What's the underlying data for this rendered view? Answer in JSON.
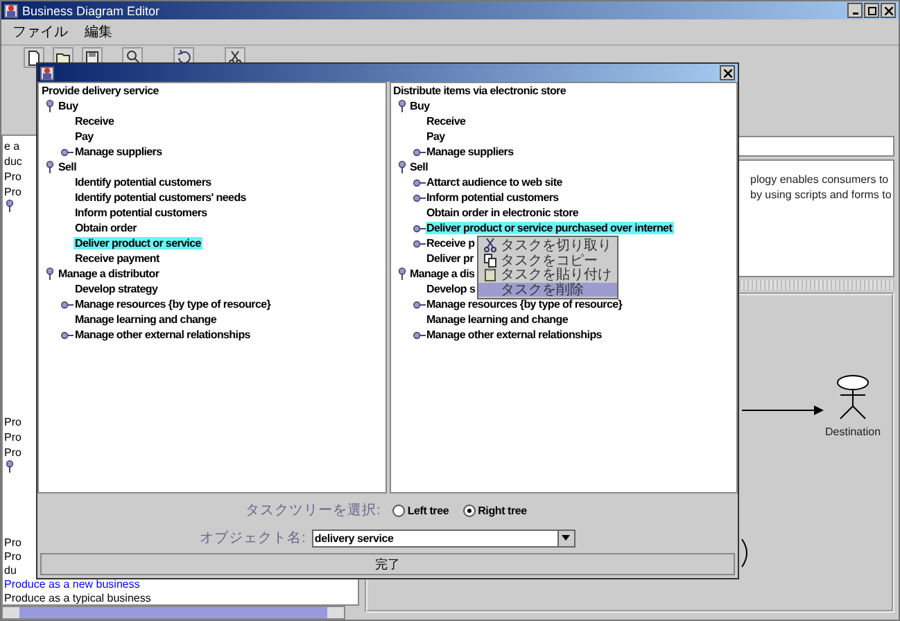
{
  "main_window": {
    "title": "Business Diagram Editor"
  },
  "menu": [
    "ファイル",
    "編集"
  ],
  "background_list": {
    "top": [
      {
        "kind": "text",
        "text": "e a"
      },
      {
        "kind": "text",
        "text": "duc"
      },
      {
        "kind": "text",
        "text": "Pro"
      },
      {
        "kind": "text",
        "text": "Pro"
      },
      {
        "kind": "pin"
      }
    ],
    "middle": [
      {
        "kind": "text",
        "text": "Pro"
      },
      {
        "kind": "text",
        "text": "Pro"
      },
      {
        "kind": "text",
        "text": "Pro"
      },
      {
        "kind": "pin"
      }
    ],
    "bottom": [
      {
        "kind": "text",
        "text": "Pro"
      },
      {
        "kind": "text",
        "text": "Pro"
      },
      {
        "kind": "text",
        "text": "du"
      },
      {
        "kind": "link",
        "text": "Produce as a new business"
      },
      {
        "kind": "text",
        "text": "Produce as a typical business"
      }
    ]
  },
  "description_fragments": [
    "plogy enables consumers to",
    "by using scripts and forms to"
  ],
  "diagram": {
    "actor_label": "Destination"
  },
  "dialog": {
    "left_tree": {
      "label": "Provide delivery service",
      "children": [
        {
          "label": "Buy",
          "expanded": true,
          "selected": false,
          "children": [
            {
              "label": "Receive",
              "selected": false
            },
            {
              "label": "Pay",
              "selected": false
            },
            {
              "label": "Manage suppliers",
              "expanded": false,
              "selected": false
            }
          ]
        },
        {
          "label": "Sell",
          "expanded": true,
          "selected": false,
          "children": [
            {
              "label": "Identify potential customers",
              "selected": false
            },
            {
              "label": "Identify potential customers' needs",
              "selected": false
            },
            {
              "label": "Inform potential customers",
              "selected": false
            },
            {
              "label": "Obtain order",
              "selected": false
            },
            {
              "label": "Deliver product or service",
              "selected": true
            },
            {
              "label": "Receive payment",
              "selected": false
            }
          ]
        },
        {
          "label": "Manage a distributor",
          "expanded": true,
          "selected": false,
          "children": [
            {
              "label": "Develop strategy",
              "selected": false
            },
            {
              "label": "Manage resources {by type of resource}",
              "expanded": false,
              "selected": false
            },
            {
              "label": "Manage learning and change",
              "selected": false
            },
            {
              "label": "Manage other external relationships",
              "expanded": false,
              "selected": false
            }
          ]
        }
      ]
    },
    "right_tree": {
      "label": "Distribute items via electronic store",
      "children": [
        {
          "label": "Buy",
          "expanded": true,
          "selected": false,
          "children": [
            {
              "label": "Receive",
              "selected": false
            },
            {
              "label": "Pay",
              "selected": false
            },
            {
              "label": "Manage suppliers",
              "expanded": false,
              "selected": false
            }
          ]
        },
        {
          "label": "Sell",
          "expanded": true,
          "selected": false,
          "children": [
            {
              "label": "Attarct audience to web site",
              "expanded": false,
              "selected": false
            },
            {
              "label": "Inform potential customers",
              "expanded": false,
              "selected": false
            },
            {
              "label": "Obtain order in electronic store",
              "selected": false
            },
            {
              "label": "Deliver product or service purchased over internet",
              "expanded": false,
              "selected": true
            },
            {
              "label": "Receive p",
              "expanded": false,
              "selected": false
            },
            {
              "label": "Deliver pr",
              "selected": false
            }
          ]
        },
        {
          "label": "Manage a dis",
          "expanded": true,
          "selected": false,
          "children": [
            {
              "label": "Develop s",
              "selected": false
            },
            {
              "label": "Manage resources {by type of resource}",
              "expanded": false,
              "selected": false
            },
            {
              "label": "Manage learning and change",
              "selected": false
            },
            {
              "label": "Manage other external relationships",
              "expanded": false,
              "selected": false
            }
          ]
        }
      ]
    },
    "tree_choice": {
      "label": "タスクツリーを選択:",
      "options": [
        {
          "label": "Left tree",
          "selected": false
        },
        {
          "label": "Right tree",
          "selected": true
        }
      ]
    },
    "object_name": {
      "label": "オブジェクト名:",
      "value": "delivery service"
    },
    "done_button": "完了"
  },
  "context_menu": [
    {
      "kind": "cut",
      "label": "タスクを切り取り",
      "selected": false
    },
    {
      "kind": "copy",
      "label": "タスクをコピー",
      "selected": false
    },
    {
      "kind": "paste",
      "label": "タスクを貼り付け",
      "selected": false
    },
    {
      "kind": "delete",
      "label": "タスクを削除",
      "selected": true
    }
  ]
}
